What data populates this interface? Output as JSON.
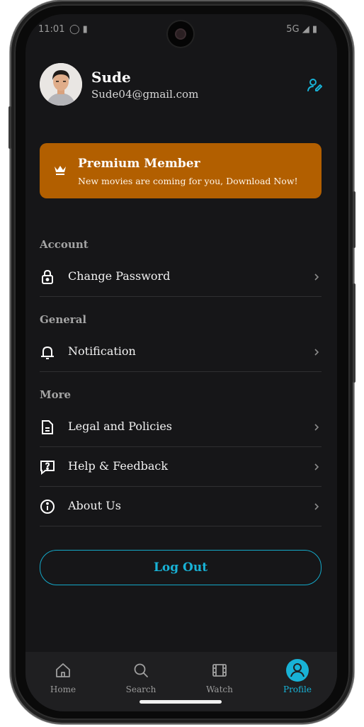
{
  "status_bar": {
    "time": "11:01",
    "network": "5G"
  },
  "profile": {
    "name": "Sude",
    "email": "Sude04@gmail.com",
    "edit_icon": "edit-user-icon"
  },
  "premium": {
    "title": "Premium Member",
    "subtitle": "New movies are coming for you, Download Now!",
    "icon": "crown-icon",
    "color": "#b25f00"
  },
  "sections": [
    {
      "heading": "Account",
      "items": [
        {
          "label": "Change Password",
          "icon": "lock-icon"
        }
      ]
    },
    {
      "heading": "General",
      "items": [
        {
          "label": "Notification",
          "icon": "bell-icon"
        }
      ]
    },
    {
      "heading": "More",
      "items": [
        {
          "label": "Legal and Policies",
          "icon": "document-icon"
        },
        {
          "label": "Help & Feedback",
          "icon": "help-message-icon"
        },
        {
          "label": "About Us",
          "icon": "info-icon"
        }
      ]
    }
  ],
  "logout": {
    "label": "Log Out"
  },
  "bottom_nav": {
    "active": "Profile",
    "accent_color": "#18b2d6",
    "tabs": [
      {
        "label": "Home",
        "icon": "home-icon"
      },
      {
        "label": "Search",
        "icon": "search-icon"
      },
      {
        "label": "Watch",
        "icon": "film-icon"
      },
      {
        "label": "Profile",
        "icon": "profile-icon"
      }
    ]
  }
}
